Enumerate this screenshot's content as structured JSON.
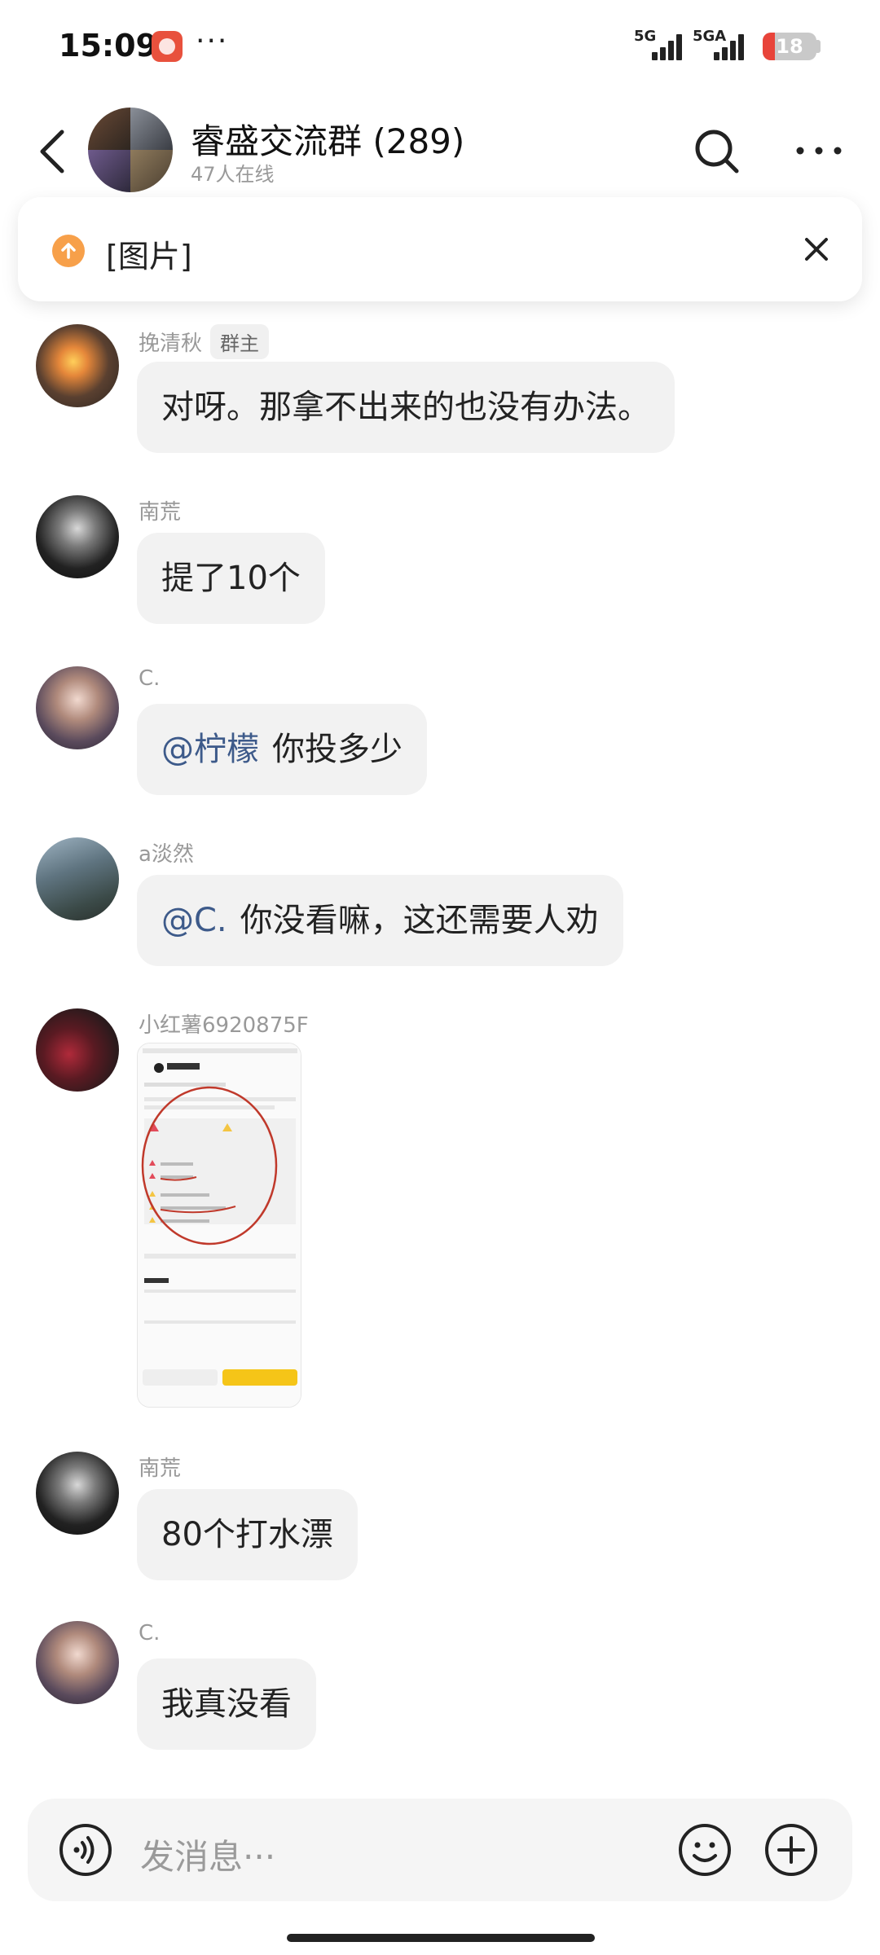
{
  "status_bar": {
    "time": "15:09",
    "app_icon": "red-app-icon",
    "dots": "···",
    "signal1_label": "5G",
    "signal2_label": "5GA",
    "battery": "18"
  },
  "header": {
    "title": "睿盛交流群 (289)",
    "online": "47人在线"
  },
  "pinned": {
    "text": "[图片]"
  },
  "messages": [
    {
      "sender": "挽清秋",
      "badge": "群主",
      "text": "对呀。那拿不出来的也没有办法。"
    },
    {
      "sender": "南荒",
      "text": "提了10个"
    },
    {
      "sender": "C.",
      "mention": "@柠檬",
      "text": "你投多少"
    },
    {
      "sender": "a淡然",
      "mention": "@C.",
      "text": "你没看嘛，这还需要人劝"
    },
    {
      "sender": "小红薯6920875F",
      "type": "image"
    },
    {
      "sender": "南荒",
      "text": "80个打水漂"
    },
    {
      "sender": "C.",
      "text": "我真没看"
    }
  ],
  "input": {
    "placeholder": "发消息···"
  },
  "colors": {
    "bubble": "#f2f2f2",
    "mention": "#3d5a8a",
    "battery_low": "#e8443a",
    "pinned_icon": "#f7a04a"
  }
}
